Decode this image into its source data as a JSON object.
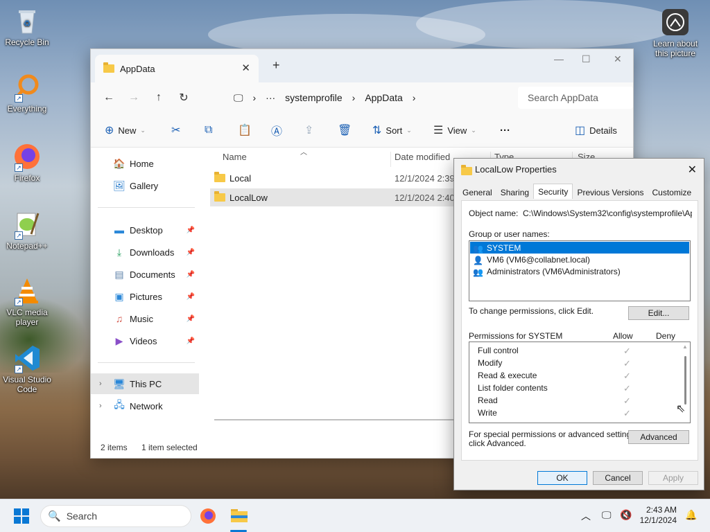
{
  "desktop": {
    "icons": [
      {
        "label": "Recycle Bin",
        "icon": "recycle-bin-icon"
      },
      {
        "label": "Everything",
        "icon": "everything-search-icon"
      },
      {
        "label": "Firefox",
        "icon": "firefox-icon"
      },
      {
        "label": "Notepad++",
        "icon": "notepad-plus-plus-icon"
      },
      {
        "label": "VLC media player",
        "icon": "vlc-icon"
      },
      {
        "label": "Visual Studio Code",
        "icon": "vscode-icon"
      }
    ],
    "learn_about": "Learn about this picture"
  },
  "explorer": {
    "tab_title": "AppData",
    "new_tab": "+",
    "breadcrumb": {
      "ellipsis": "···",
      "items": [
        "systemprofile",
        "AppData"
      ]
    },
    "search_placeholder": "Search AppData",
    "toolbar": {
      "new_label": "New",
      "sort_label": "Sort",
      "view_label": "View",
      "more_label": "···",
      "details_label": "Details"
    },
    "sidebar": {
      "home": "Home",
      "gallery": "Gallery",
      "quick": [
        "Desktop",
        "Downloads",
        "Documents",
        "Pictures",
        "Music",
        "Videos"
      ],
      "this_pc": "This PC",
      "network": "Network"
    },
    "columns": {
      "name": "Name",
      "date": "Date modified",
      "type": "Type",
      "size": "Size"
    },
    "rows": [
      {
        "name": "Local",
        "date": "12/1/2024 2:39 A"
      },
      {
        "name": "LocalLow",
        "date": "12/1/2024 2:40 A"
      }
    ],
    "status": {
      "count": "2 items",
      "selected": "1 item selected"
    }
  },
  "properties": {
    "title": "LocalLow Properties",
    "tabs": [
      "General",
      "Sharing",
      "Security",
      "Previous Versions",
      "Customize"
    ],
    "active_tab": "Security",
    "object_name_label": "Object name:",
    "object_name_value": "C:\\Windows\\System32\\config\\systemprofile\\AppD",
    "group_label": "Group or user names:",
    "users": [
      "SYSTEM",
      "VM6 (VM6@collabnet.local)",
      "Administrators (VM6\\Administrators)"
    ],
    "change_text": "To change permissions, click Edit.",
    "edit_button": "Edit...",
    "perm_label": "Permissions for SYSTEM",
    "allow_label": "Allow",
    "deny_label": "Deny",
    "permissions": [
      "Full control",
      "Modify",
      "Read & execute",
      "List folder contents",
      "Read",
      "Write"
    ],
    "special_text_1": "For special permissions or advanced settings,",
    "special_text_2": "click Advanced.",
    "advanced_button": "Advanced",
    "ok_button": "OK",
    "cancel_button": "Cancel",
    "apply_button": "Apply"
  },
  "taskbar": {
    "search_placeholder": "Search",
    "time": "2:43 AM",
    "date": "12/1/2024"
  }
}
